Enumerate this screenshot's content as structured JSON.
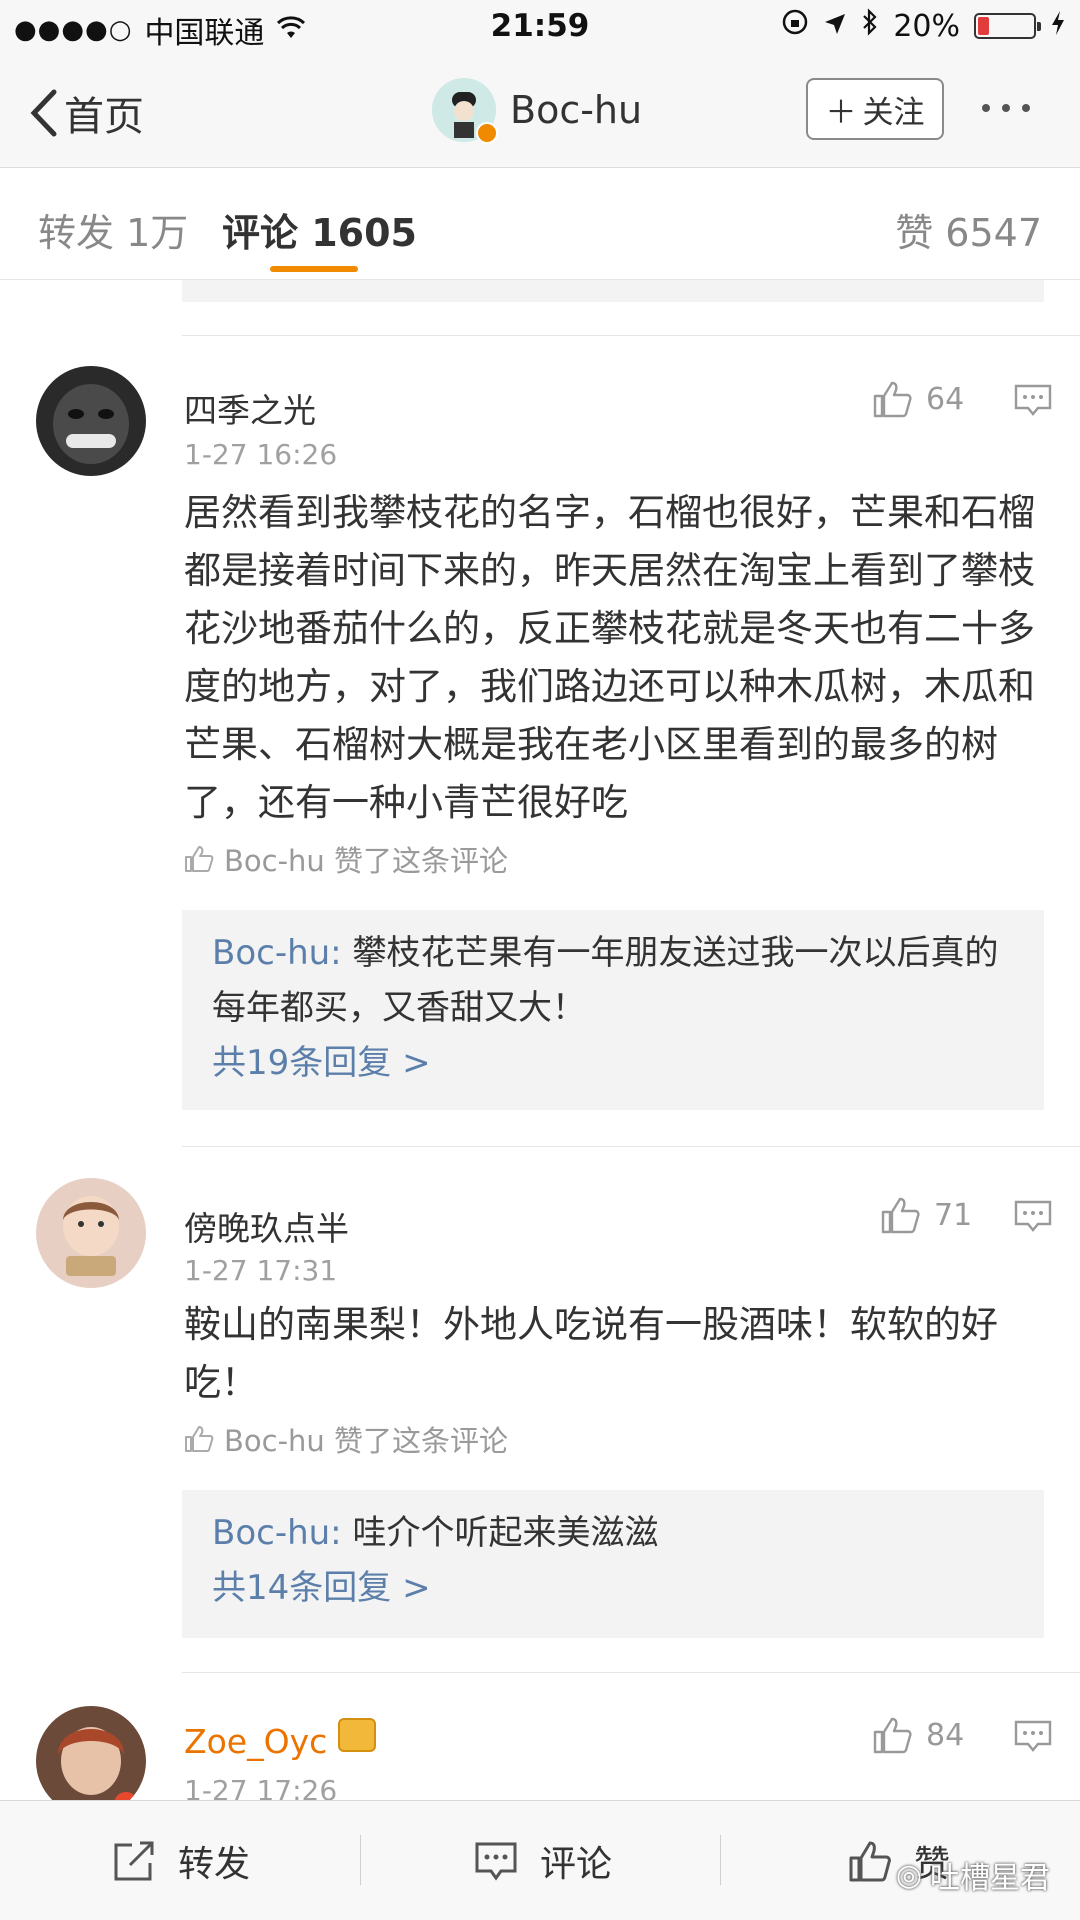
{
  "status_bar": {
    "carrier": "中国联通",
    "signal": "●●●●○",
    "time": "21:59",
    "battery": "20%"
  },
  "nav": {
    "back_label": "首页",
    "title": "Boc-hu",
    "follow_label": "关注"
  },
  "tabs": {
    "repost": "转发 1万",
    "comment": "评论 1605",
    "like": "赞 6547"
  },
  "comments": [
    {
      "user": "四季之光",
      "time": "1-27 16:26",
      "likes": "64",
      "text": "居然看到我攀枝花的名字，石榴也很好，芒果和石榴都是接着时间下来的，昨天居然在淘宝上看到了攀枝花沙地番茄什么的，反正攀枝花就是冬天也有二十多度的地方，对了，我们路边还可以种木瓜树，木瓜和芒果、石榴树大概是我在老小区里看到的最多的树了，还有一种小青芒很好吃",
      "liked_by": "Boc-hu 赞了这条评论",
      "reply_user": "Boc-hu:",
      "reply_text": " 攀枝花芒果有一年朋友送过我一次以后真的每年都买，又香甜又大！",
      "reply_count": "共19条回复 >"
    },
    {
      "user": "傍晚玖点半",
      "time": "1-27 17:31",
      "likes": "71",
      "text": "鞍山的南果梨！外地人吃说有一股酒味！软软的好吃！",
      "liked_by": "Boc-hu 赞了这条评论",
      "reply_user": "Boc-hu:",
      "reply_text": " 哇介个听起来美滋滋",
      "reply_count": "共14条回复 >"
    },
    {
      "user": "Zoe_Oyc",
      "time": "1-27 17:26",
      "likes": "84"
    }
  ],
  "bottom_bar": {
    "repost": "转发",
    "comment": "评论",
    "like": "赞",
    "watermark": "吐槽星君"
  },
  "colors": {
    "accent": "#f08a00",
    "link": "#5b7faa",
    "username_vip": "#eb7300"
  }
}
